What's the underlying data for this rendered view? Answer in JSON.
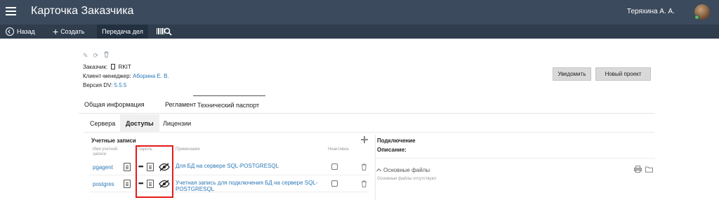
{
  "header": {
    "title": "Карточка Заказчика",
    "user_name": "Теряхина А. А."
  },
  "toolbar": {
    "back_label": "Назад",
    "create_label": "Создать",
    "transfer_label": "Передача дел"
  },
  "customer": {
    "customer_label": "Заказчик:",
    "customer_value": "RKIT",
    "manager_label": "Клиент-менеджер:",
    "manager_value": "Аборина Е. В.",
    "version_label": "Версия DV:",
    "version_value": "5.5.5"
  },
  "buttons": {
    "notify": "Уведомить",
    "new_project": "Новый проект"
  },
  "tabs": [
    "Общая информация",
    "Регламент",
    "Технический паспорт"
  ],
  "subtabs": [
    "Сервера",
    "Доступы",
    "Лицензии"
  ],
  "accounts": {
    "title": "Учетные записи",
    "columns": {
      "name": "Имя учетной записи",
      "password": "Пароль",
      "note": "Примечание",
      "inactive": "Неактивна"
    },
    "rows": [
      {
        "name": "pgagent",
        "password_mask": "•••",
        "note": "Для БД на сервере SQL-POSTGRESQL",
        "inactive": false
      },
      {
        "name": "postgres",
        "password_mask": "•••",
        "note": "Учетная запись для подключения БД на сервере SQL-POSTGRESQL",
        "inactive": false
      }
    ]
  },
  "connection": {
    "title": "Подключение",
    "description_label": "Описание:",
    "files_label": "Основные файлы",
    "files_empty": "Основные файлы отсутствуют"
  },
  "colors": {
    "topbar": "#3b4a5c",
    "toolbar": "#2f3d4d",
    "link": "#2b78b7",
    "highlight": "#e31b1b"
  },
  "icons": [
    "menu-icon",
    "back-icon",
    "plus-icon",
    "barcode-search-icon",
    "edit-icon",
    "refresh-icon",
    "delete-icon",
    "document-icon",
    "copy-icon",
    "eye-off-icon",
    "trash-icon",
    "print-icon",
    "folder-icon"
  ]
}
